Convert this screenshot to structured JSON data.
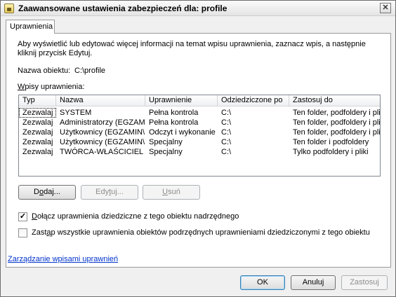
{
  "window": {
    "title": "Zaawansowane ustawienia zabezpieczeń dla: profile",
    "close_glyph": "✕"
  },
  "tabs": [
    {
      "label": "Uprawnienia",
      "active": true
    }
  ],
  "permissions": {
    "description": "Aby wyświetlić lub edytować więcej informacji na temat wpisu uprawnienia, zaznacz wpis, a następnie kliknij przycisk Edytuj.",
    "object_name_label": "Nazwa obiektu:",
    "object_name_value": "C:\\profile",
    "entries_label_pre": "",
    "entries_label_accel": "W",
    "entries_label_post": "pisy uprawnienia:",
    "columns": [
      "Typ",
      "Nazwa",
      "Uprawnienie",
      "Odziedziczone po",
      "Zastosuj do"
    ],
    "rows": [
      [
        "Zezwalaj",
        "SYSTEM",
        "Pełna kontrola",
        "C:\\",
        "Ten folder, podfoldery i pliki"
      ],
      [
        "Zezwalaj",
        "Administratorzy (EGZAM...",
        "Pełna kontrola",
        "C:\\",
        "Ten folder, podfoldery i pliki"
      ],
      [
        "Zezwalaj",
        "Użytkownicy (EGZAMIN\\...",
        "Odczyt i wykonanie",
        "C:\\",
        "Ten folder, podfoldery i pliki"
      ],
      [
        "Zezwalaj",
        "Użytkownicy (EGZAMIN\\...",
        "Specjalny",
        "C:\\",
        "Ten folder i podfoldery"
      ],
      [
        "Zezwalaj",
        "TWÓRCA-WŁAŚCICIEL",
        "Specjalny",
        "C:\\",
        "Tylko podfoldery i pliki"
      ]
    ],
    "buttons": {
      "add_pre": "D",
      "add_accel": "o",
      "add_post": "daj...",
      "edit_pre": "Edy",
      "edit_accel": "t",
      "edit_post": "uj...",
      "remove_pre": "",
      "remove_accel": "U",
      "remove_post": "suń"
    },
    "inherit_checkbox": {
      "checked": true,
      "glyph": "✓",
      "pre": "",
      "accel": "D",
      "post": "ołącz uprawnienia dziedziczne z tego obiektu nadrzędnego"
    },
    "replace_checkbox": {
      "checked": false,
      "pre": "Zast",
      "accel": "ą",
      "post": "p wszystkie uprawnienia obiektów podrzędnych uprawnieniami dziedziczonymi z tego obiektu"
    },
    "manage_link": "Zarządzanie wpisami uprawnień"
  },
  "footer": {
    "ok": "OK",
    "cancel": "Anuluj",
    "apply": "Zastosuj"
  }
}
